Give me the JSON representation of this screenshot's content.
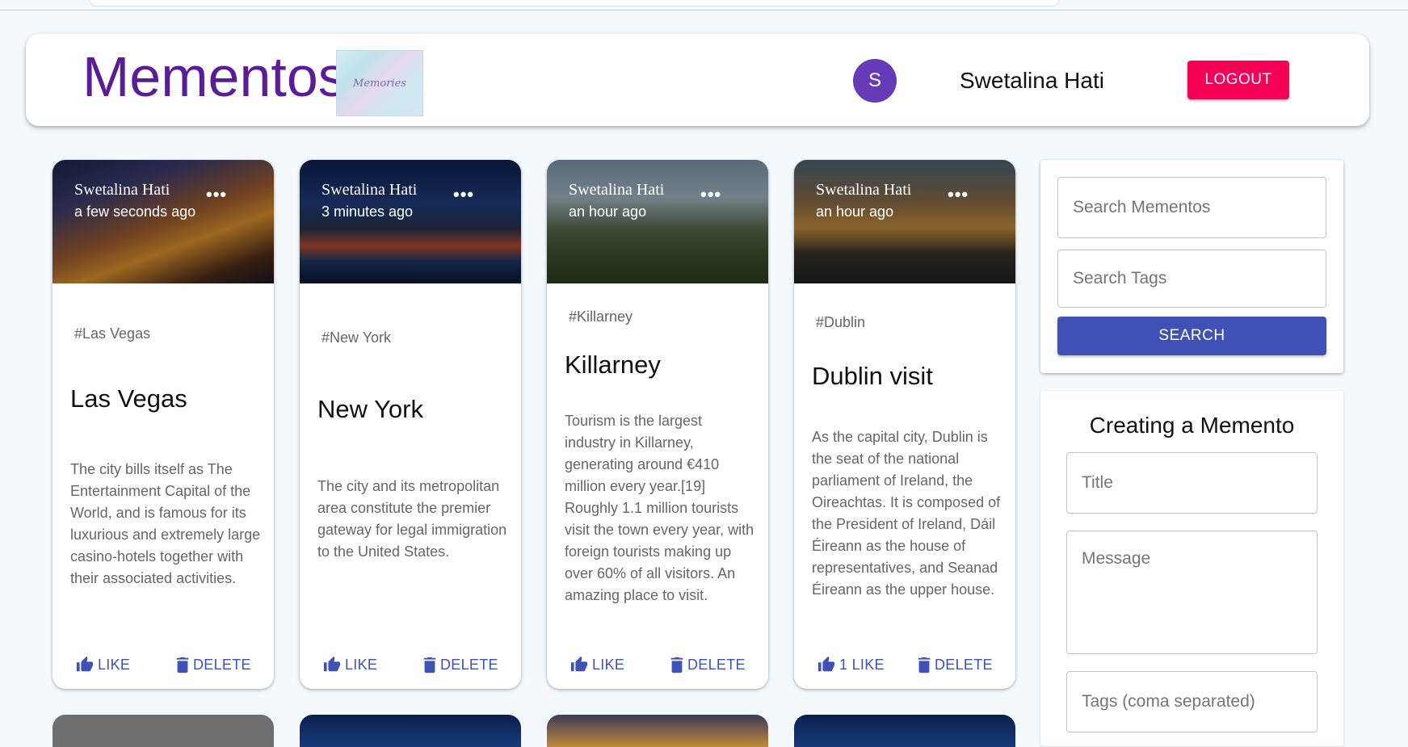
{
  "header": {
    "brand_title": "Mementos",
    "logo_text": "Memories",
    "avatar_letter": "S",
    "user_name": "Swetalina Hati",
    "logout_label": "LOGOUT"
  },
  "posts": [
    {
      "author": "Swetalina Hati",
      "time": "a few seconds ago",
      "tags": "#Las Vegas",
      "title": "Las Vegas",
      "message": "The city bills itself as The Entertainment Capital of the World, and is famous for its luxurious and extremely large casino-hotels together with their associated activities.",
      "like_label": "LIKE",
      "delete_label": "DELETE"
    },
    {
      "author": "Swetalina Hati",
      "time": "3 minutes ago",
      "tags": "#New York",
      "title": "New York",
      "message": "The city and its metropolitan area constitute the premier gateway for legal immigration to the United States.",
      "like_label": "LIKE",
      "delete_label": "DELETE"
    },
    {
      "author": "Swetalina Hati",
      "time": "an hour ago",
      "tags": "#Killarney",
      "title": "Killarney",
      "message": "Tourism is the largest industry in Killarney, generating around €410 million every year.[19] Roughly 1.1 million tourists visit the town every year, with foreign tourists making up over 60% of all visitors. An amazing place to visit.",
      "like_label": "LIKE",
      "delete_label": "DELETE"
    },
    {
      "author": "Swetalina Hati",
      "time": "an hour ago",
      "tags": "#Dublin",
      "title": "Dublin visit",
      "message": "As the capital city, Dublin is the seat of the national parliament of Ireland, the Oireachtas. It is composed of the President of Ireland, Dáil Éireann as the house of representatives, and Seanad Éireann as the upper house.",
      "like_label": "1 LIKE",
      "delete_label": "DELETE"
    }
  ],
  "search": {
    "mementos_placeholder": "Search Mementos",
    "tags_placeholder": "Search Tags",
    "button_label": "SEARCH"
  },
  "create_form": {
    "heading": "Creating a Memento",
    "title_placeholder": "Title",
    "message_placeholder": "Message",
    "tags_placeholder": "Tags (coma separated)"
  },
  "colors": {
    "brand": "#5b1c98",
    "avatar": "#673ab7",
    "logout": "#f50057",
    "primary": "#3f51b5",
    "page_bg": "#f3f9fc"
  }
}
